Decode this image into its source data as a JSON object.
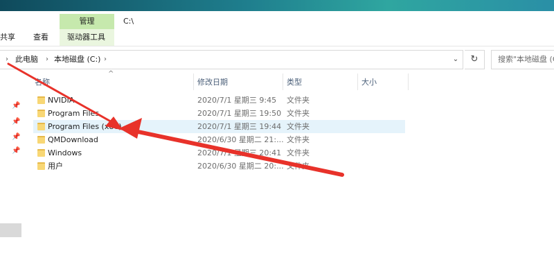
{
  "ribbon": {
    "manage_tab": "管理",
    "title_path": "C:\\",
    "tabs": [
      "共享",
      "查看",
      "驱动器工具"
    ]
  },
  "address": {
    "crumbs": [
      "此电脑",
      "本地磁盘 (C:)"
    ],
    "search_placeholder": "搜索\"本地磁盘 (C:)\""
  },
  "columns": {
    "name": "名称",
    "date": "修改日期",
    "type": "类型",
    "size": "大小"
  },
  "files": [
    {
      "name": "NVIDIA",
      "date": "2020/7/1 星期三 9:45",
      "type": "文件夹",
      "selected": false
    },
    {
      "name": "Program Files",
      "date": "2020/7/1 星期三 19:50",
      "type": "文件夹",
      "selected": false
    },
    {
      "name": "Program Files (x86)",
      "date": "2020/7/1 星期三 19:44",
      "type": "文件夹",
      "selected": true
    },
    {
      "name": "QMDownload",
      "date": "2020/6/30 星期二 21:...",
      "type": "文件夹",
      "selected": false
    },
    {
      "name": "Windows",
      "date": "2020/7/1 星期三 20:41",
      "type": "文件夹",
      "selected": false
    },
    {
      "name": "用户",
      "date": "2020/6/30 星期二 20:...",
      "type": "文件夹",
      "selected": false
    }
  ],
  "colors": {
    "manage_tab": "#c6e9ad",
    "selected_row": "#e5f3fb",
    "annotation_arrow": "#e8322a"
  }
}
